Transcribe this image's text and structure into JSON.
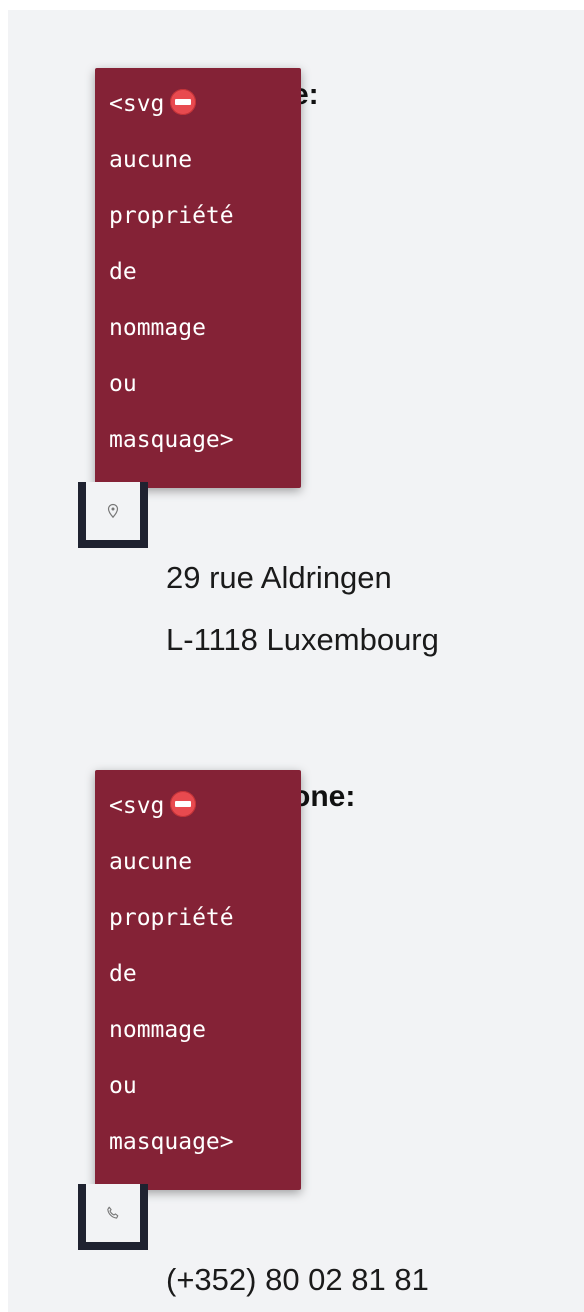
{
  "address": {
    "label_visible": "e:",
    "tooltip": {
      "prefix": "<svg",
      "icon": "no-entry-icon",
      "lines": [
        "aucune",
        "propriété",
        "de",
        "nommage",
        "ou",
        "masquage>"
      ]
    },
    "icon": "map-pin-icon",
    "lines": [
      "29 rue Aldringen",
      "L-1118 Luxembourg"
    ]
  },
  "phone": {
    "label_visible": "one:",
    "tooltip": {
      "prefix": "<svg",
      "icon": "no-entry-icon",
      "lines": [
        "aucune",
        "propriété",
        "de",
        "nommage",
        "ou",
        "masquage>"
      ]
    },
    "icon": "phone-icon",
    "value": "(+352) 80 02 81 81"
  },
  "colors": {
    "tooltip_bg": "#842236",
    "panel_bg": "#f2f3f5",
    "focus_frame": "#1f2230",
    "no_entry": "#e84a4f"
  }
}
